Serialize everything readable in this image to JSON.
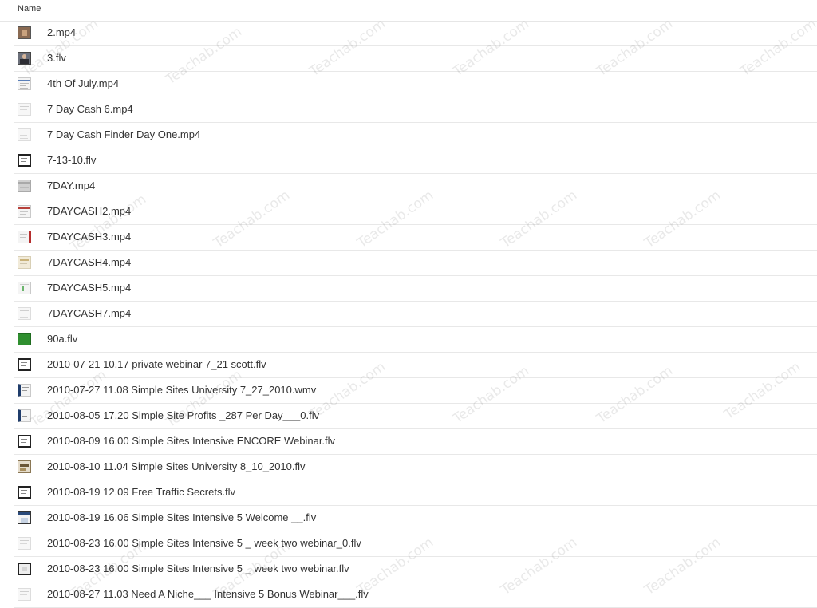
{
  "header": {
    "name_column": "Name"
  },
  "files": [
    {
      "name": "2.mp4",
      "icon": "video-thumbnail-photo-icon"
    },
    {
      "name": "3.flv",
      "icon": "video-thumbnail-person-icon"
    },
    {
      "name": "4th Of July.mp4",
      "icon": "video-thumbnail-document-icon"
    },
    {
      "name": "7 Day Cash 6.mp4",
      "icon": "video-thumbnail-faint-icon"
    },
    {
      "name": "7 Day Cash Finder Day One.mp4",
      "icon": "video-thumbnail-faint-icon"
    },
    {
      "name": "7-13-10.flv",
      "icon": "video-thumbnail-dark-icon"
    },
    {
      "name": "7DAY.mp4",
      "icon": "video-thumbnail-grey-icon"
    },
    {
      "name": "7DAYCASH2.mp4",
      "icon": "video-thumbnail-red-icon"
    },
    {
      "name": "7DAYCASH3.mp4",
      "icon": "video-thumbnail-red-side-icon"
    },
    {
      "name": "7DAYCASH4.mp4",
      "icon": "video-thumbnail-tan-icon"
    },
    {
      "name": "7DAYCASH5.mp4",
      "icon": "video-thumbnail-green-icon"
    },
    {
      "name": "7DAYCASH7.mp4",
      "icon": "video-thumbnail-faint-icon"
    },
    {
      "name": "90a.flv",
      "icon": "video-thumbnail-solid-green-icon"
    },
    {
      "name": "2010-07-21 10.17 private webinar 7_21 scott.flv",
      "icon": "video-thumbnail-dark-icon"
    },
    {
      "name": "2010-07-27 11.08 Simple Sites University 7_27_2010.wmv",
      "icon": "video-thumbnail-navy-icon"
    },
    {
      "name": "2010-08-05 17.20 Simple Site Profits _287 Per Day___0.flv",
      "icon": "video-thumbnail-navy-icon"
    },
    {
      "name": "2010-08-09 16.00 Simple Sites Intensive ENCORE Webinar.flv",
      "icon": "video-thumbnail-dark-icon"
    },
    {
      "name": "2010-08-10 11.04 Simple Sites University 8_10_2010.flv",
      "icon": "video-thumbnail-brown-icon"
    },
    {
      "name": "2010-08-19 12.09 Free Traffic Secrets.flv",
      "icon": "video-thumbnail-dark-icon"
    },
    {
      "name": "2010-08-19 16.06 Simple Sites Intensive 5 Welcome __.flv",
      "icon": "video-thumbnail-window-icon"
    },
    {
      "name": "2010-08-23 16.00 Simple Sites Intensive 5 _ week two webinar_0.flv",
      "icon": "video-thumbnail-faint-icon"
    },
    {
      "name": "2010-08-23 16.00 Simple Sites Intensive 5 _ week two webinar.flv",
      "icon": "video-thumbnail-screen-icon"
    },
    {
      "name": "2010-08-27 11.03 Need A Niche___ Intensive 5 Bonus Webinar___.flv",
      "icon": "video-thumbnail-faint-icon"
    }
  ],
  "watermark": {
    "text": "Teachab.com"
  }
}
